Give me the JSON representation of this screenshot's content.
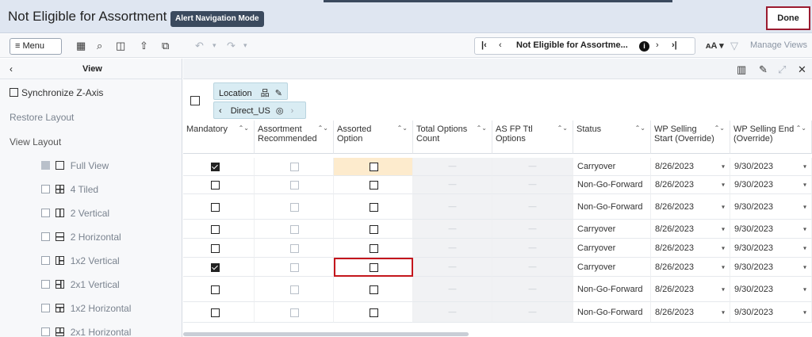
{
  "titlebar": {
    "title": "Not Eligible for Assortment",
    "badge": "Alert Navigation Mode",
    "done_label": "Done"
  },
  "toolbar": {
    "menu_label": "≡ Menu",
    "alert_name": "Not Eligible for Assortme...",
    "text_size_label": "ᴀA ▾",
    "manage_views_label": "Manage Views",
    "info_label": "i"
  },
  "left_panel": {
    "back": "‹",
    "title": "View",
    "synchronize": "Synchronize Z-Axis",
    "restore": "Restore Layout",
    "view_layout": "View Layout",
    "layouts": [
      {
        "label": "Full View",
        "checked": true
      },
      {
        "label": "4 Tiled",
        "checked": false
      },
      {
        "label": "2 Vertical",
        "checked": false
      },
      {
        "label": "2 Horizontal",
        "checked": false
      },
      {
        "label": "1x2 Vertical",
        "checked": false
      },
      {
        "label": "2x1 Vertical",
        "checked": false
      },
      {
        "label": "1x2 Horizontal",
        "checked": false
      },
      {
        "label": "2x1 Horizontal",
        "checked": false
      }
    ]
  },
  "pivot": {
    "dimension": "Location",
    "member": "Direct_US"
  },
  "grid": {
    "columns": [
      {
        "key": "mandatory",
        "label": "Mandatory"
      },
      {
        "key": "recommended",
        "label": "Assortment Recommended"
      },
      {
        "key": "assorted",
        "label": "Assorted Option"
      },
      {
        "key": "total",
        "label": "Total Options Count"
      },
      {
        "key": "asfp",
        "label": "AS FP Ttl Options"
      },
      {
        "key": "status",
        "label": "Status"
      },
      {
        "key": "start",
        "label": "WP Selling Start (Override)"
      },
      {
        "key": "end",
        "label": "WP Selling End (Override)"
      }
    ],
    "empty_placeholder": "—",
    "rows": [
      {
        "mandatory": true,
        "status": "Carryover",
        "start": "8/26/2023",
        "end": "9/30/2023"
      },
      {
        "mandatory": false,
        "status": "Non-Go-Forward",
        "start": "8/26/2023",
        "end": "9/30/2023"
      },
      {
        "mandatory": false,
        "status": "Non-Go-Forward",
        "start": "8/26/2023",
        "end": "9/30/2023"
      },
      {
        "mandatory": false,
        "status": "Carryover",
        "start": "8/26/2023",
        "end": "9/30/2023"
      },
      {
        "mandatory": false,
        "status": "Carryover",
        "start": "8/26/2023",
        "end": "9/30/2023"
      },
      {
        "mandatory": true,
        "status": "Carryover",
        "start": "8/26/2023",
        "end": "9/30/2023"
      },
      {
        "mandatory": false,
        "status": "Non-Go-Forward",
        "start": "8/26/2023",
        "end": "9/30/2023"
      },
      {
        "mandatory": false,
        "status": "Non-Go-Forward",
        "start": "8/26/2023",
        "end": "9/30/2023"
      }
    ]
  },
  "colors": {
    "accent_done_border": "#9b1b30",
    "highlight_cell": "#fdebcd",
    "selection_border": "#c4161c"
  }
}
